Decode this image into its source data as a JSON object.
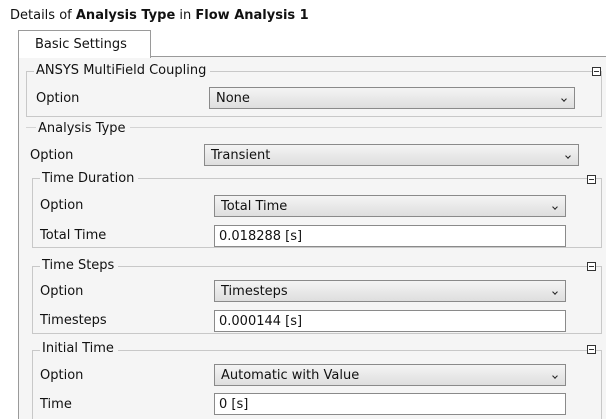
{
  "header": {
    "prefix": "Details of ",
    "object": "Analysis Type",
    "middle": " in ",
    "container": "Flow Analysis 1"
  },
  "tabs": [
    {
      "label": "Basic Settings",
      "active": true
    }
  ],
  "multifield": {
    "title": "ANSYS MultiField Coupling",
    "option_label": "Option",
    "option_value": "None"
  },
  "analysis_type": {
    "title": "Analysis Type",
    "option_label": "Option",
    "option_value": "Transient"
  },
  "time_duration": {
    "title": "Time Duration",
    "option_label": "Option",
    "option_value": "Total Time",
    "field_label": "Total Time",
    "field_value": "0.018288 [s]"
  },
  "time_steps": {
    "title": "Time Steps",
    "option_label": "Option",
    "option_value": "Timesteps",
    "field_label": "Timesteps",
    "field_value": "0.000144 [s]"
  },
  "initial_time": {
    "title": "Initial Time",
    "option_label": "Option",
    "option_value": "Automatic with Value",
    "field_label": "Time",
    "field_value": "0 [s]"
  },
  "colors": {
    "panel_bg": "#f5f5f5",
    "border": "#9a9a9a"
  },
  "icons": [
    "collapse-icon",
    "chevron-down-icon"
  ]
}
